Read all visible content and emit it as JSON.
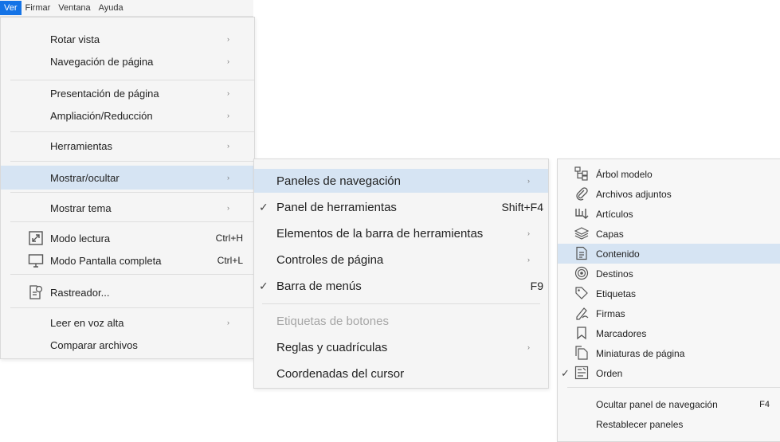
{
  "menubar": {
    "items": [
      "Ver",
      "Firmar",
      "Ventana",
      "Ayuda"
    ]
  },
  "view_menu": {
    "rotate": "Rotar vista",
    "page_nav": "Navegación de página",
    "page_display": "Presentación de página",
    "zoom": "Ampliación/Reducción",
    "tools": "Herramientas",
    "show_hide": "Mostrar/ocultar",
    "show_theme": "Mostrar tema",
    "read_mode": "Modo lectura",
    "read_mode_sc": "Ctrl+H",
    "full_screen": "Modo Pantalla completa",
    "full_screen_sc": "Ctrl+L",
    "tracker": "Rastreador...",
    "read_aloud": "Leer en voz alta",
    "compare": "Comparar archivos"
  },
  "show_hide_menu": {
    "nav_panels": "Paneles de navegación",
    "tools_panel": "Panel de herramientas",
    "tools_panel_sc": "Shift+F4",
    "toolbar_items": "Elementos de la barra de herramientas",
    "page_controls": "Controles de página",
    "menu_bar": "Barra de menús",
    "menu_bar_sc": "F9",
    "button_labels": "Etiquetas de botones",
    "rulers_grids": "Reglas y cuadrículas",
    "cursor_coords": "Coordenadas del cursor"
  },
  "nav_panels_menu": {
    "items": [
      "Árbol modelo",
      "Archivos adjuntos",
      "Artículos",
      "Capas",
      "Contenido",
      "Destinos",
      "Etiquetas",
      "Firmas",
      "Marcadores",
      "Miniaturas de página",
      "Orden"
    ],
    "hide_panel": "Ocultar panel de navegación",
    "hide_panel_sc": "F4",
    "reset_panels": "Restablecer paneles"
  },
  "colors": {
    "accent": "#1473e6",
    "highlight": "#d6e4f3",
    "menu_bg": "#f5f5f5"
  }
}
